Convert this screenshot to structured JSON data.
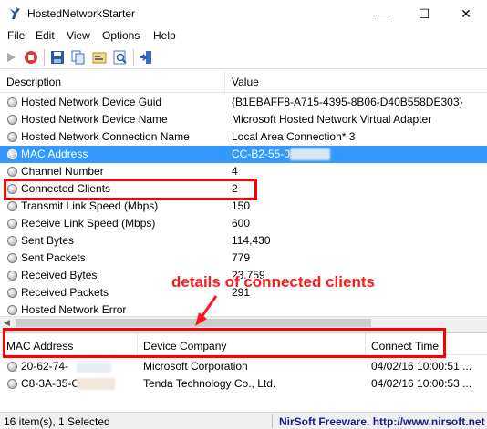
{
  "window": {
    "title": "HostedNetworkStarter",
    "minimize": "—",
    "maximize": "☐",
    "close": "✕"
  },
  "menu": [
    "File",
    "Edit",
    "View",
    "Options",
    "Help"
  ],
  "upper": {
    "columns": {
      "description": "Description",
      "value": "Value"
    },
    "rows": [
      {
        "desc": "Hosted Network Device Guid",
        "val": "{B1EBAFF8-A715-4395-8B06-D40B558DE303}"
      },
      {
        "desc": "Hosted Network Device Name",
        "val": "Microsoft Hosted Network Virtual Adapter"
      },
      {
        "desc": "Hosted Network Connection Name",
        "val": "Local Area Connection* 3"
      },
      {
        "desc": "MAC Address",
        "val": "CC-B2-55-0"
      },
      {
        "desc": "Channel Number",
        "val": "4"
      },
      {
        "desc": "Connected Clients",
        "val": "2"
      },
      {
        "desc": "Transmit Link Speed (Mbps)",
        "val": "150"
      },
      {
        "desc": "Receive Link Speed (Mbps)",
        "val": "600"
      },
      {
        "desc": "Sent Bytes",
        "val": "114,430"
      },
      {
        "desc": "Sent Packets",
        "val": "779"
      },
      {
        "desc": "Received Bytes",
        "val": "23,759"
      },
      {
        "desc": "Received Packets",
        "val": "291"
      },
      {
        "desc": "Hosted Network Error",
        "val": ""
      }
    ]
  },
  "lower": {
    "columns": {
      "mac": "MAC Address",
      "company": "Device Company",
      "time": "Connect Time"
    },
    "rows": [
      {
        "mac": "20-62-74-",
        "company": "Microsoft Corporation",
        "time": "04/02/16 10:00:51 ..."
      },
      {
        "mac": "C8-3A-35-C",
        "company": "Tenda Technology Co., Ltd.",
        "time": "04/02/16 10:00:53 ..."
      }
    ]
  },
  "annotation": "details of connected clients",
  "status": {
    "items": "16 item(s), 1 Selected",
    "vendor": "NirSoft Freeware.  http://www.nirsoft.net"
  },
  "colors": {
    "selection": "#3399ff",
    "highlight": "#ff0000"
  }
}
